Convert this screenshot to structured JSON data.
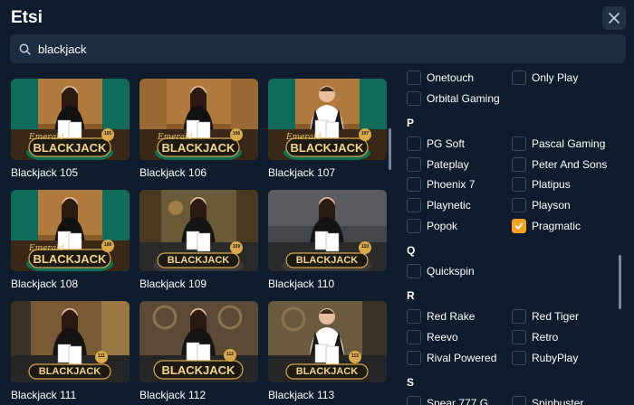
{
  "header": {
    "title": "Etsi"
  },
  "search": {
    "value": "blackjack"
  },
  "games": [
    {
      "label": "Blackjack 105",
      "badge": "105",
      "logo": "BLACKJACK",
      "sub": "Emerald",
      "bg": "#8a5a2a",
      "dealer": "f"
    },
    {
      "label": "Blackjack 106",
      "badge": "106",
      "logo": "BLACKJACK",
      "sub": "Emerald",
      "bg": "#8a5a2a",
      "dealer": "f"
    },
    {
      "label": "Blackjack 107",
      "badge": "107",
      "logo": "BLACKJACK",
      "sub": "Emerald",
      "bg": "#8a5a2a",
      "dealer": "m"
    },
    {
      "label": "Blackjack 108",
      "badge": "108",
      "logo": "BLACKJACK",
      "sub": "Emerald",
      "bg": "#8a5a2a",
      "dealer": "f"
    },
    {
      "label": "Blackjack 109",
      "badge": "109",
      "logo": "BLACKJACK",
      "sub": "",
      "bg": "#6b5a38",
      "dealer": "f"
    },
    {
      "label": "Blackjack 110",
      "badge": "110",
      "logo": "BLACKJACK",
      "sub": "",
      "bg": "#45464a",
      "dealer": "f"
    },
    {
      "label": "Blackjack 111",
      "badge": "111",
      "logo": "BLACKJACK",
      "sub": "",
      "bg": "#7a5a34",
      "dealer": "f"
    },
    {
      "label": "Blackjack 112",
      "badge": "112",
      "logo": "BLACKJACK",
      "sub": "",
      "bg": "#5a4a36",
      "dealer": "f"
    },
    {
      "label": "Blackjack 113",
      "badge": "113",
      "logo": "BLACKJACK",
      "sub": "",
      "bg": "#6a5a40",
      "dealer": "m"
    }
  ],
  "filters": {
    "letters": [
      "P",
      "Q",
      "R",
      "S"
    ],
    "items": [
      {
        "label": "Onetouch",
        "checked": false
      },
      {
        "label": "Only Play",
        "checked": false
      },
      {
        "label": "Orbital Gaming",
        "checked": false
      },
      {
        "label": "PG Soft",
        "checked": false
      },
      {
        "label": "Pascal Gaming",
        "checked": false
      },
      {
        "label": "Pateplay",
        "checked": false
      },
      {
        "label": "Peter And Sons",
        "checked": false
      },
      {
        "label": "Phoenix 7",
        "checked": false
      },
      {
        "label": "Platipus",
        "checked": false
      },
      {
        "label": "Playnetic",
        "checked": false
      },
      {
        "label": "Playson",
        "checked": false
      },
      {
        "label": "Popok",
        "checked": false
      },
      {
        "label": "Pragmatic",
        "checked": true
      },
      {
        "label": "Quickspin",
        "checked": false
      },
      {
        "label": "Red Rake",
        "checked": false
      },
      {
        "label": "Red Tiger",
        "checked": false
      },
      {
        "label": "Reevo",
        "checked": false
      },
      {
        "label": "Retro",
        "checked": false
      },
      {
        "label": "Rival Powered",
        "checked": false
      },
      {
        "label": "RubyPlay",
        "checked": false
      },
      {
        "label": "Spear 777 G",
        "checked": false
      },
      {
        "label": "Spinbuster",
        "checked": false
      }
    ]
  },
  "colors": {
    "background": "#0f1c2d",
    "surface": "#1c2d43",
    "accent": "#f4a11d",
    "text": "#ffffff"
  }
}
